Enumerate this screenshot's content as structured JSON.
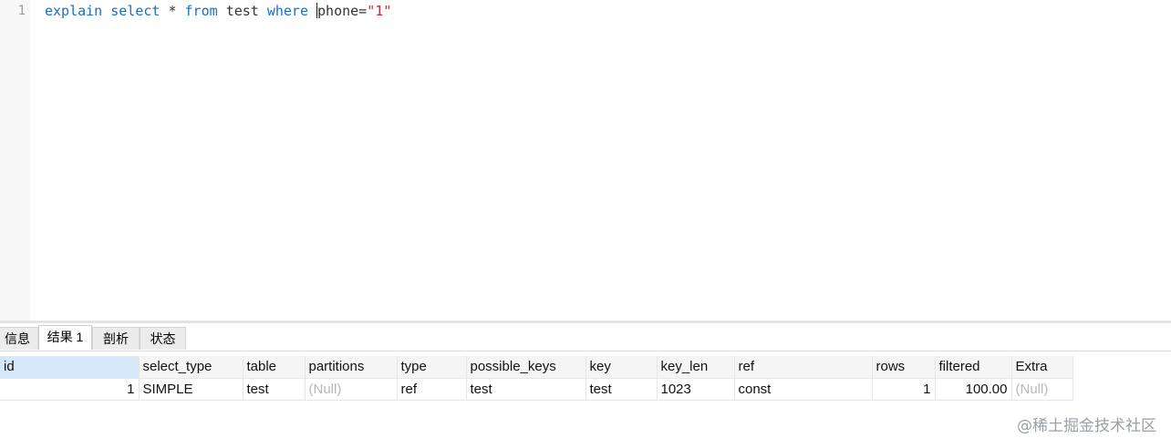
{
  "editor": {
    "line_number": "1",
    "code": {
      "kw_explain": "explain",
      "kw_select": "select",
      "star": "*",
      "kw_from": "from",
      "table": "test",
      "kw_where": "where",
      "column": "phone=",
      "value": "\"1\""
    }
  },
  "tabs": [
    {
      "label": "信息"
    },
    {
      "label": "结果 1"
    },
    {
      "label": "剖析"
    },
    {
      "label": "状态"
    }
  ],
  "grid": {
    "columns": [
      "id",
      "select_type",
      "table",
      "partitions",
      "type",
      "possible_keys",
      "key",
      "key_len",
      "ref",
      "rows",
      "filtered",
      "Extra"
    ],
    "rows": [
      [
        "1",
        "SIMPLE",
        "test",
        "(Null)",
        "ref",
        "test",
        "test",
        "1023",
        "const",
        "1",
        "100.00",
        "(Null)"
      ]
    ]
  },
  "watermark": "@稀土掘金技术社区",
  "colors": {
    "keyword": "#1a6fc2",
    "string": "#d7263d",
    "selected_header": "#d6e7f9",
    "null_text": "#b8b8b8"
  }
}
